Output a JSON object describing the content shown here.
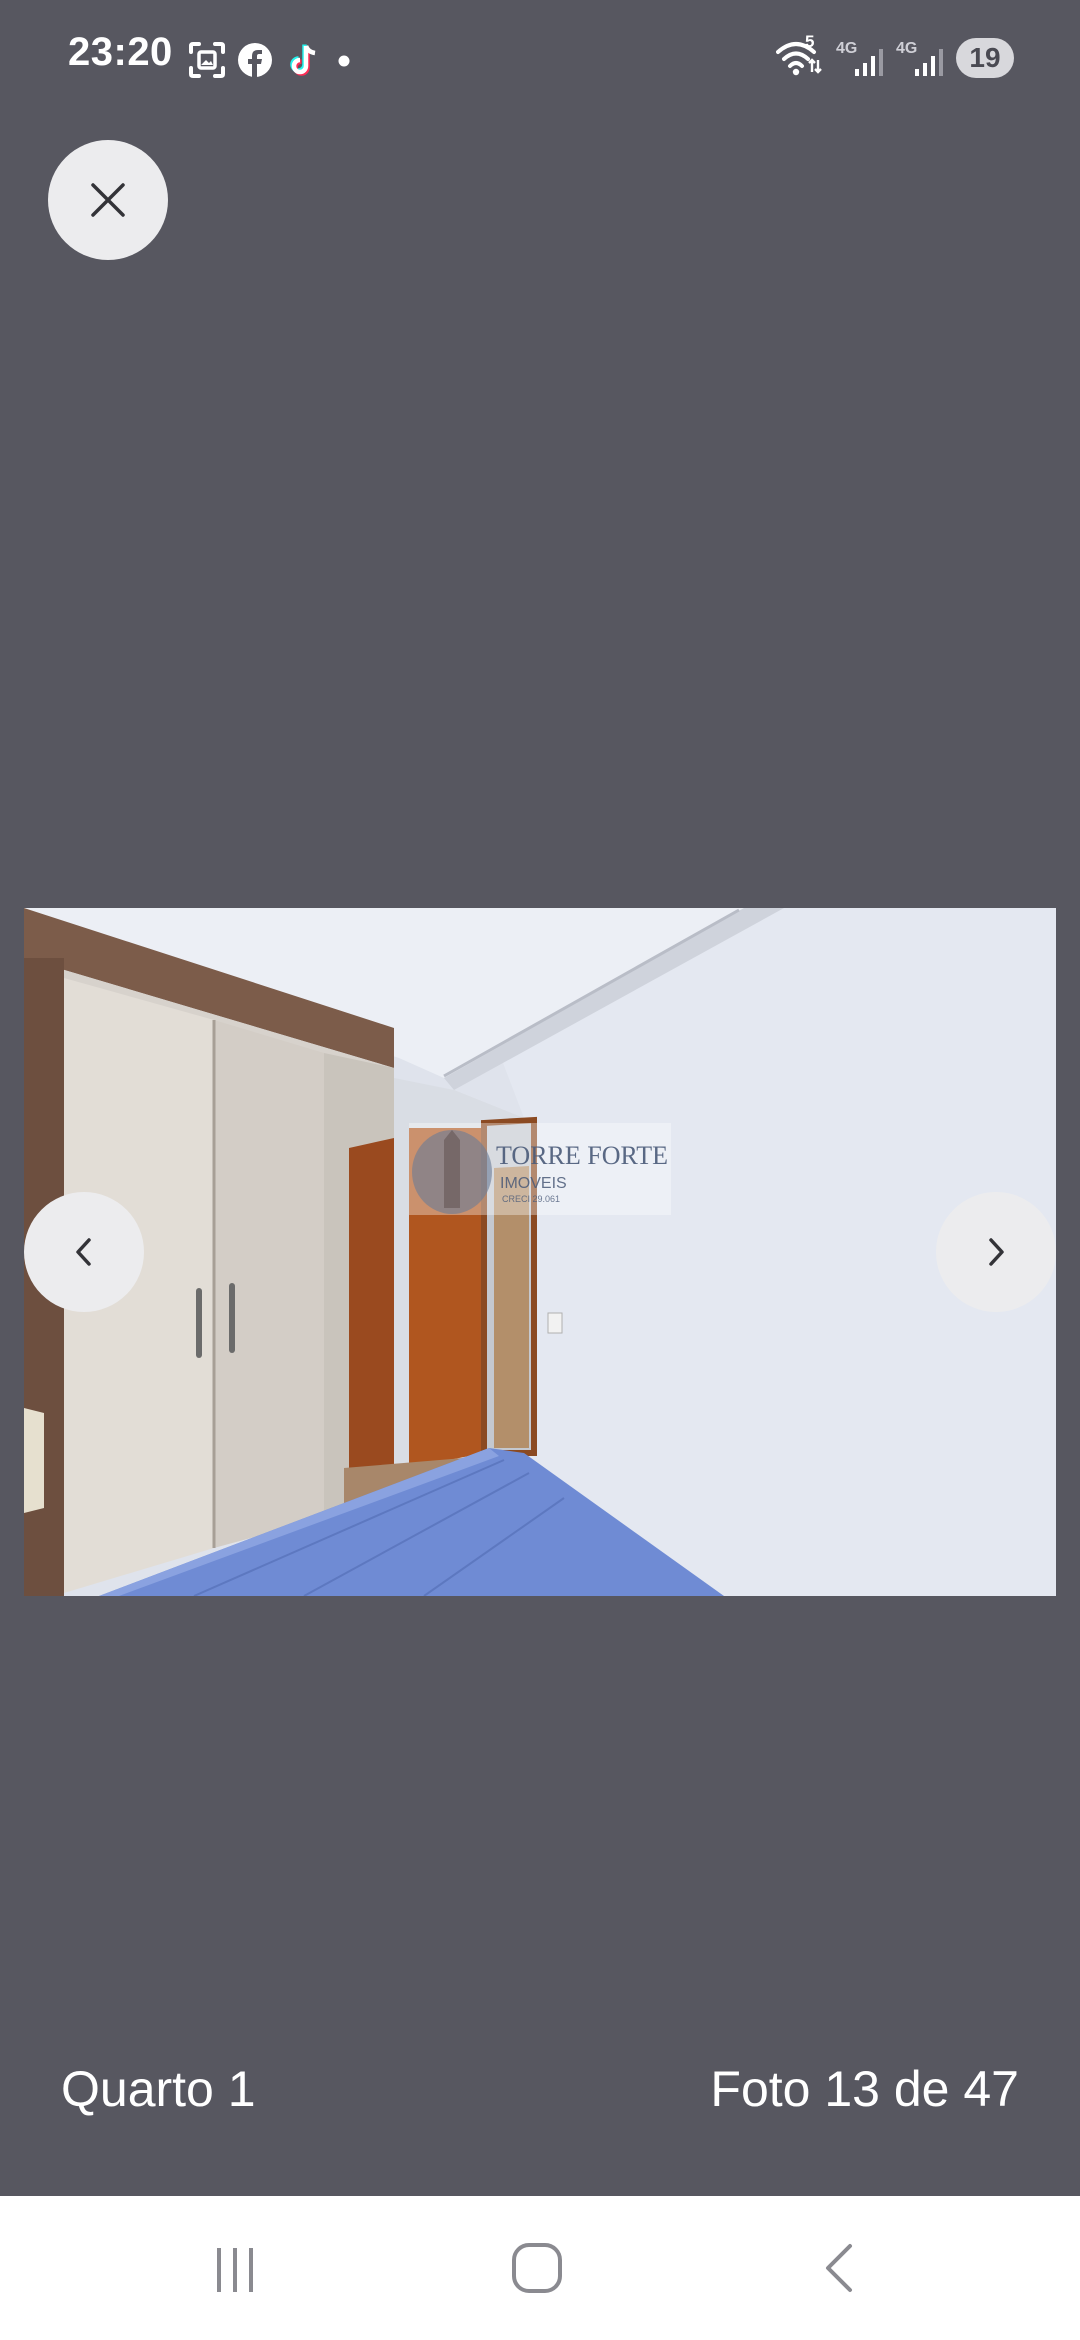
{
  "status_bar": {
    "time": "23:20",
    "notification_icons": [
      "screenshot-icon",
      "facebook-icon",
      "tiktok-icon",
      "dot-icon"
    ],
    "wifi_label": "5",
    "network_1": "4G",
    "network_2": "4G",
    "battery": "19"
  },
  "viewer": {
    "close_icon": "close-icon",
    "prev_icon": "chevron-left-icon",
    "next_icon": "chevron-right-icon",
    "photo": {
      "watermark_title": "TORRE FORTE",
      "watermark_subtitle": "IMOVEIS",
      "watermark_reg": "CRECI 29.061"
    },
    "title": "Quarto 1",
    "counter": "Foto 13 de 47"
  },
  "nav_bar": {
    "recents_icon": "recents-icon",
    "home_icon": "home-icon",
    "back_icon": "back-icon"
  },
  "colors": {
    "background": "#575760",
    "button_bg": "#ececee",
    "nav_bg": "#ffffff",
    "nav_icon": "#8a8a90"
  }
}
